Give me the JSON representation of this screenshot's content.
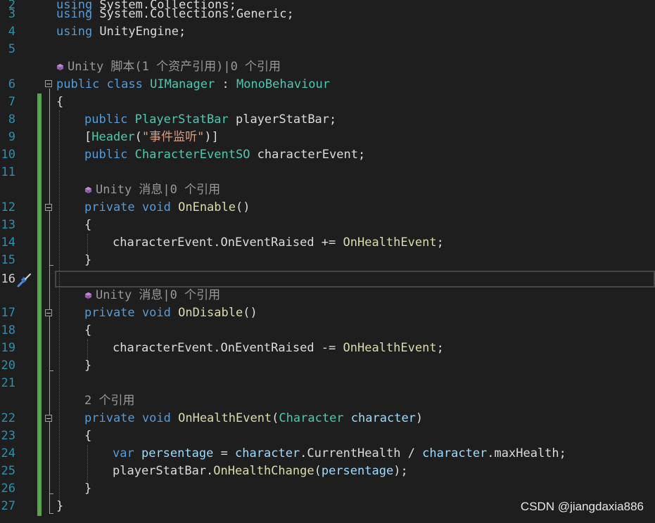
{
  "lines": [
    {
      "n": "2",
      "tokens": [
        {
          "c": "kw",
          "t": "using"
        },
        {
          "c": "plain",
          "t": " System.Collections;"
        }
      ]
    },
    {
      "n": "3",
      "tokens": [
        {
          "c": "kw",
          "t": "using"
        },
        {
          "c": "plain",
          "t": " System.Collections.Generic;"
        }
      ]
    },
    {
      "n": "4",
      "tokens": [
        {
          "c": "kw",
          "t": "using"
        },
        {
          "c": "plain",
          "t": " UnityEngine;"
        }
      ]
    },
    {
      "n": "5",
      "tokens": []
    },
    {
      "n": "6",
      "tokens": [
        {
          "c": "kw",
          "t": "public"
        },
        {
          "c": "plain",
          "t": " "
        },
        {
          "c": "kw",
          "t": "class"
        },
        {
          "c": "plain",
          "t": " "
        },
        {
          "c": "ty",
          "t": "UIManager"
        },
        {
          "c": "plain",
          "t": " : "
        },
        {
          "c": "ty",
          "t": "MonoBehaviour"
        }
      ]
    },
    {
      "n": "7",
      "tokens": [
        {
          "c": "plain",
          "t": "{"
        }
      ]
    },
    {
      "n": "8",
      "tokens": [
        {
          "c": "kw",
          "t": "public"
        },
        {
          "c": "plain",
          "t": " "
        },
        {
          "c": "ty",
          "t": "PlayerStatBar"
        },
        {
          "c": "plain",
          "t": " playerStatBar;"
        }
      ]
    },
    {
      "n": "9",
      "tokens": [
        {
          "c": "plain",
          "t": "["
        },
        {
          "c": "ty",
          "t": "Header"
        },
        {
          "c": "plain",
          "t": "("
        },
        {
          "c": "str",
          "t": "\"事件监听\""
        },
        {
          "c": "plain",
          "t": ")]"
        }
      ]
    },
    {
      "n": "10",
      "tokens": [
        {
          "c": "kw",
          "t": "public"
        },
        {
          "c": "plain",
          "t": " "
        },
        {
          "c": "ty",
          "t": "CharacterEventSO"
        },
        {
          "c": "plain",
          "t": " characterEvent;"
        }
      ]
    },
    {
      "n": "11",
      "tokens": []
    },
    {
      "n": "12",
      "tokens": [
        {
          "c": "kw",
          "t": "private"
        },
        {
          "c": "plain",
          "t": " "
        },
        {
          "c": "kw",
          "t": "void"
        },
        {
          "c": "plain",
          "t": " "
        },
        {
          "c": "fn",
          "t": "OnEnable"
        },
        {
          "c": "plain",
          "t": "()"
        }
      ]
    },
    {
      "n": "13",
      "tokens": [
        {
          "c": "plain",
          "t": "{"
        }
      ]
    },
    {
      "n": "14",
      "tokens": [
        {
          "c": "plain",
          "t": "characterEvent.OnEventRaised += "
        },
        {
          "c": "fn",
          "t": "OnHealthEvent"
        },
        {
          "c": "plain",
          "t": ";"
        }
      ]
    },
    {
      "n": "15",
      "tokens": [
        {
          "c": "plain",
          "t": "}"
        }
      ]
    },
    {
      "n": "16",
      "tokens": []
    },
    {
      "n": "17",
      "tokens": [
        {
          "c": "kw",
          "t": "private"
        },
        {
          "c": "plain",
          "t": " "
        },
        {
          "c": "kw",
          "t": "void"
        },
        {
          "c": "plain",
          "t": " "
        },
        {
          "c": "fn",
          "t": "OnDisable"
        },
        {
          "c": "plain",
          "t": "()"
        }
      ]
    },
    {
      "n": "18",
      "tokens": [
        {
          "c": "plain",
          "t": "{"
        }
      ]
    },
    {
      "n": "19",
      "tokens": [
        {
          "c": "plain",
          "t": "characterEvent.OnEventRaised -= "
        },
        {
          "c": "fn",
          "t": "OnHealthEvent"
        },
        {
          "c": "plain",
          "t": ";"
        }
      ]
    },
    {
      "n": "20",
      "tokens": [
        {
          "c": "plain",
          "t": "}"
        }
      ]
    },
    {
      "n": "21",
      "tokens": []
    },
    {
      "n": "22",
      "tokens": [
        {
          "c": "kw",
          "t": "private"
        },
        {
          "c": "plain",
          "t": " "
        },
        {
          "c": "kw",
          "t": "void"
        },
        {
          "c": "plain",
          "t": " "
        },
        {
          "c": "fn",
          "t": "OnHealthEvent"
        },
        {
          "c": "plain",
          "t": "("
        },
        {
          "c": "ty",
          "t": "Character"
        },
        {
          "c": "plain",
          "t": " "
        },
        {
          "c": "pv",
          "t": "character"
        },
        {
          "c": "plain",
          "t": ")"
        }
      ]
    },
    {
      "n": "23",
      "tokens": [
        {
          "c": "plain",
          "t": "{"
        }
      ]
    },
    {
      "n": "24",
      "tokens": [
        {
          "c": "kw",
          "t": "var"
        },
        {
          "c": "plain",
          "t": " "
        },
        {
          "c": "pv",
          "t": "persentage"
        },
        {
          "c": "plain",
          "t": " = "
        },
        {
          "c": "pv",
          "t": "character"
        },
        {
          "c": "plain",
          "t": ".CurrentHealth / "
        },
        {
          "c": "pv",
          "t": "character"
        },
        {
          "c": "plain",
          "t": ".maxHealth;"
        }
      ]
    },
    {
      "n": "25",
      "tokens": [
        {
          "c": "plain",
          "t": "playerStatBar."
        },
        {
          "c": "fn",
          "t": "OnHealthChange"
        },
        {
          "c": "plain",
          "t": "("
        },
        {
          "c": "pv",
          "t": "persentage"
        },
        {
          "c": "plain",
          "t": ");"
        }
      ]
    },
    {
      "n": "26",
      "tokens": [
        {
          "c": "plain",
          "t": "}"
        }
      ]
    },
    {
      "n": "27",
      "tokens": [
        {
          "c": "plain",
          "t": "}"
        }
      ]
    }
  ],
  "codelens": [
    {
      "icon": "unity-cube-icon",
      "text": "Unity 脚本(1 个资产引用)|0 个引用"
    },
    {
      "icon": "unity-cube-icon",
      "text": "Unity 消息|0 个引用"
    },
    {
      "icon": "unity-cube-icon",
      "text": "Unity 消息|0 个引用"
    },
    {
      "icon": "",
      "text": "2 个引用"
    }
  ],
  "current_line": "16",
  "watermark": "CSDN @jiangdaxia886",
  "colors": {
    "background": "#1e1e1e",
    "keyword": "#569cd6",
    "type": "#4ec9b0",
    "method": "#dcdcaa",
    "string": "#d69d85",
    "parameter": "#9cdcfe",
    "line_number": "#2b91af",
    "change_bar": "#57a64a"
  }
}
